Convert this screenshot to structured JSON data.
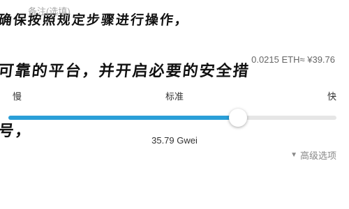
{
  "background_text": {
    "line1": "确保按照规定步骤进行操作，",
    "line2": "可靠的平台，并开启必要的安全措",
    "line3": "号，"
  },
  "widget": {
    "backup_hint": "备注(选填)",
    "fee_readout": "0.0215 ETH≈ ¥39.76",
    "speed": {
      "slow": "慢",
      "standard": "标准",
      "fast": "快"
    },
    "slider_level": 0.7,
    "accent_color": "#2a9fd8",
    "gas_price": "35.79 Gwei",
    "advanced_label": "高级选项",
    "advanced_icon": "caret-down-icon"
  }
}
